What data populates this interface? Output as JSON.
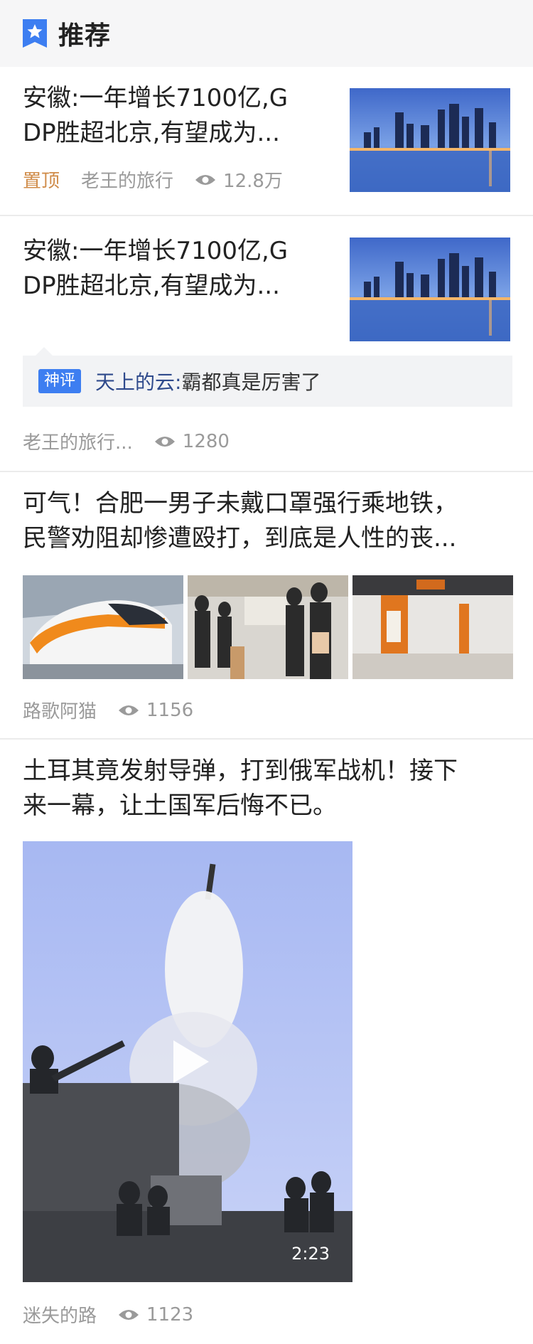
{
  "header": {
    "title": "推荐",
    "icon": "star-bookmark-icon",
    "accent": "#3d7ef1"
  },
  "articles": [
    {
      "title_line1": "安徽:一年增长7100亿,G",
      "title_line2": "DP胜超北京,有望成为...",
      "pinned_label": "置顶",
      "author": "老王的旅行",
      "views": "12.8万",
      "image": "city-skyline-night"
    },
    {
      "title_line1": "安徽:一年增长7100亿,G",
      "title_line2": "DP胜超北京,有望成为...",
      "image": "city-skyline-night",
      "comment": {
        "badge": "神评",
        "user": "天上的云:",
        "text": "霸都真是厉害了"
      },
      "author": "老王的旅行...",
      "views": "1280"
    },
    {
      "title_line1": "可气！合肥一男子未戴口罩强行乘地铁，",
      "title_line2": "民警劝阻却惨遭殴打，到底是人性的丧...",
      "images": [
        "orange-white-train",
        "passengers-queue-platform",
        "orange-metro-station"
      ],
      "author": "路歌阿猫",
      "views": "1156"
    },
    {
      "title_line1": "土耳其竟发射导弹，打到俄军战机！接下",
      "title_line2": "来一幕，让土国军后悔不已。",
      "video": {
        "thumbnail": "missile-launch-soldiers",
        "duration": "2:23"
      },
      "author": "迷失的路",
      "views": "1123"
    }
  ],
  "colors": {
    "pinned": "#d08c4a",
    "meta": "#9a9a9a",
    "commentUser": "#2f4a8c"
  }
}
